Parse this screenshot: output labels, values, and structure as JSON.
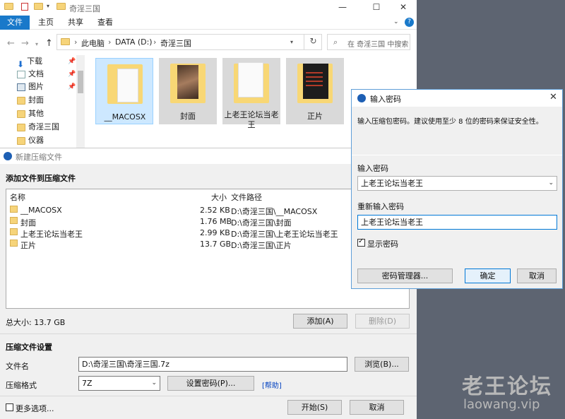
{
  "explorer": {
    "title": "奇淫三国",
    "ribbon_tabs": [
      "文件",
      "主页",
      "共享",
      "查看"
    ],
    "breadcrumb": [
      "此电脑",
      "DATA (D:)",
      "奇淫三国"
    ],
    "search_placeholder": "在 奇淫三国 中搜索",
    "nav_items": [
      {
        "label": "下载",
        "icon": "download-icon",
        "pinned": true
      },
      {
        "label": "文档",
        "icon": "document-icon",
        "pinned": true
      },
      {
        "label": "图片",
        "icon": "picture-icon",
        "pinned": true
      },
      {
        "label": "封面",
        "icon": "folder-icon",
        "pinned": false
      },
      {
        "label": "其他",
        "icon": "folder-icon",
        "pinned": false
      },
      {
        "label": "奇淫三国",
        "icon": "folder-icon",
        "pinned": false
      },
      {
        "label": "仪器",
        "icon": "folder-icon",
        "pinned": false
      }
    ],
    "tiles": [
      {
        "name": "__MACOSX",
        "selected": true
      },
      {
        "name": "封面",
        "selected": false
      },
      {
        "name": "上老王论坛当老",
        "name2": "王",
        "selected": false
      },
      {
        "name": "正片",
        "selected": false
      }
    ]
  },
  "archive": {
    "title": "新建压缩文件",
    "section_add": "添加文件到压缩文件",
    "columns": {
      "name": "名称",
      "size": "大小",
      "path": "文件路径"
    },
    "rows": [
      {
        "name": "__MACOSX",
        "size": "2.52 KB",
        "path": "D:\\奇淫三国\\__MACOSX"
      },
      {
        "name": "封面",
        "size": "1.76 MB",
        "path": "D:\\奇淫三国\\封面"
      },
      {
        "name": "上老王论坛当老王",
        "size": "2.99 KB",
        "path": "D:\\奇淫三国\\上老王论坛当老王"
      },
      {
        "name": "正片",
        "size": "13.7 GB",
        "path": "D:\\奇淫三国\\正片"
      }
    ],
    "total": "总大小: 13.7 GB",
    "add_btn": "添加(A)",
    "delete_btn": "删除(D)",
    "section_settings": "压缩文件设置",
    "filename_label": "文件名",
    "filename_value": "D:\\奇淫三国\\奇淫三国.7z",
    "browse_btn": "浏览(B)...",
    "format_label": "压缩格式",
    "format_value": "7Z",
    "set_pwd_btn": "设置密码(P)...",
    "help_link": "[帮助]",
    "more_options": "更多选项...",
    "start_btn": "开始(S)",
    "cancel_btn": "取消"
  },
  "password": {
    "title": "输入密码",
    "note": "输入压缩包密码。建议使用至少 8 位的密码来保证安全性。",
    "enter_label": "输入密码",
    "enter_value": "上老王论坛当老王",
    "reenter_label": "重新输入密码",
    "reenter_value": "上老王论坛当老王",
    "show_label": "显示密码",
    "show_checked": true,
    "manager_btn": "密码管理器...",
    "ok_btn": "确定",
    "cancel_btn": "取消"
  },
  "watermark": {
    "line1": "老王论坛",
    "line2": "laowang.vip"
  }
}
